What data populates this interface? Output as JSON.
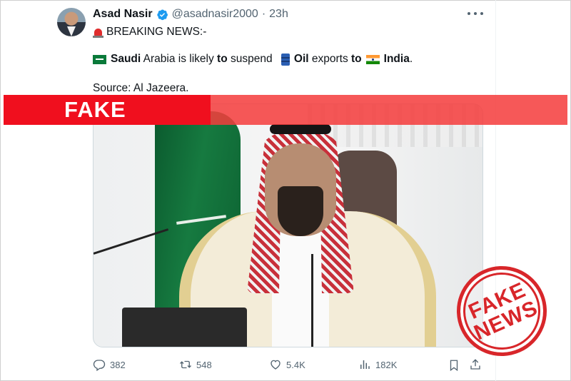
{
  "tweet": {
    "author_name": "Asad Nasir",
    "handle": "@asadnasir2000",
    "separator": "·",
    "time": "23h",
    "line1": "BREAKING NEWS:-",
    "line2": {
      "w1": "Saudi",
      "w2": " Arabia is likely ",
      "w3": "to",
      "w4": " suspend ",
      "w5": "Oil",
      "w6": " exports ",
      "w7": "to",
      "w8": "India",
      "w9": "."
    },
    "line3": "Source: Al Jazeera."
  },
  "overlay": {
    "banner_label": "FAKE",
    "stamp_line1": "FAKE",
    "stamp_line2": "NEWS"
  },
  "actions": {
    "replies": "382",
    "reposts": "548",
    "likes": "5.4K",
    "views": "182K"
  },
  "icons": {
    "verified": "verified-badge-icon",
    "more": "more-options-icon",
    "reply": "reply-icon",
    "repost": "repost-icon",
    "like": "heart-icon",
    "views": "bar-chart-icon",
    "bookmark": "bookmark-icon",
    "share": "share-icon"
  },
  "colors": {
    "verified_blue": "#1d9bf0",
    "fake_red": "#f00f1e",
    "stamp_red": "#d8262a",
    "muted_text": "#536471"
  }
}
